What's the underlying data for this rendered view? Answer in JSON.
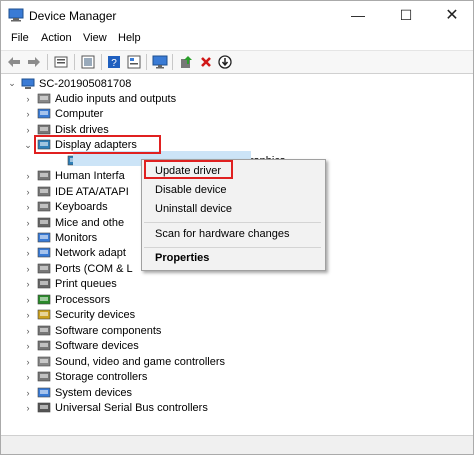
{
  "window": {
    "title": "Device Manager",
    "controls": [
      "—",
      "☐",
      "✕"
    ]
  },
  "menu": [
    "File",
    "Action",
    "View",
    "Help"
  ],
  "toolbar": {
    "buttons": [
      "back-icon",
      "forward-icon",
      "properties-icon",
      "show-hidden-icon",
      "help-icon",
      "device-view-icon",
      "monitor-icon",
      "update-driver-icon",
      "uninstall-icon",
      "scan-download-icon"
    ]
  },
  "tree": {
    "root": "SC-201905081708",
    "categories": [
      "Audio inputs and outputs",
      "Computer",
      "Disk drives",
      "Display adapters",
      "AMD Radeon (TM) RX Vega 11 Graphics",
      "Human Interface Devices",
      "IDE ATA/ATAPI controllers",
      "Keyboards",
      "Mice and other pointing devices",
      "Monitors",
      "Network adapters",
      "Ports (COM & LPT)",
      "Print queues",
      "Processors",
      "Security devices",
      "Software components",
      "Software devices",
      "Sound, video and game controllers",
      "Storage controllers",
      "System devices",
      "Universal Serial Bus controllers"
    ],
    "visible_labels": {
      "human": "Human Interfa",
      "ide": "IDE ATA/ATAPI",
      "mice": "Mice and othe",
      "network": "Network adapt",
      "ports": "Ports (COM & L",
      "amd": "AMD Radeon (TM) RX Vega 11 Graphics"
    }
  },
  "context_menu": {
    "items": [
      "Update driver",
      "Disable device",
      "Uninstall device",
      "Scan for hardware changes",
      "Properties"
    ]
  },
  "colors": {
    "highlight_box": "#e02020",
    "selection": "#cce4f7",
    "menu_bg": "#f2f2f2"
  }
}
